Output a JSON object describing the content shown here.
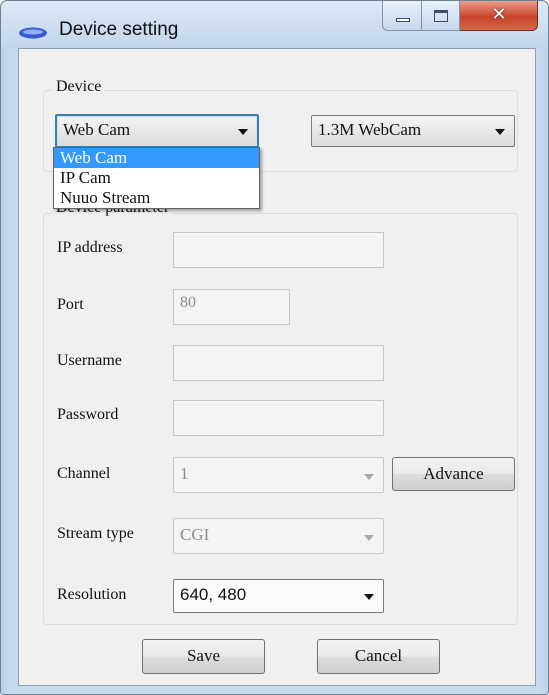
{
  "window": {
    "title": "Device setting",
    "close_glyph": "✕"
  },
  "device_group": {
    "label": "Device",
    "device_type": "Web Cam",
    "device_model": "1.3M WebCam",
    "dropdown_options": [
      "Web Cam",
      "IP Cam",
      "Nuuo Stream"
    ]
  },
  "params_group": {
    "label": "Device parameter",
    "ip_address_label": "IP address",
    "port_label": "Port",
    "port_value": "80",
    "username_label": "Username",
    "password_label": "Password",
    "channel_label": "Channel",
    "channel_value": "1",
    "advance_label": "Advance",
    "stream_type_label": "Stream type",
    "stream_type_value": "CGI",
    "resolution_label": "Resolution",
    "resolution_value": "640, 480"
  },
  "footer": {
    "save_label": "Save",
    "cancel_label": "Cancel"
  },
  "colors": {
    "selection": "#3399ff",
    "focus_border": "#3c7fb1",
    "close_button": "#c7432a"
  },
  "icons": {
    "app": "webcam-icon",
    "minimize": "minimize-icon",
    "maximize": "maximize-icon",
    "close": "close-icon",
    "dropdown_arrow": "chevron-down-icon"
  }
}
